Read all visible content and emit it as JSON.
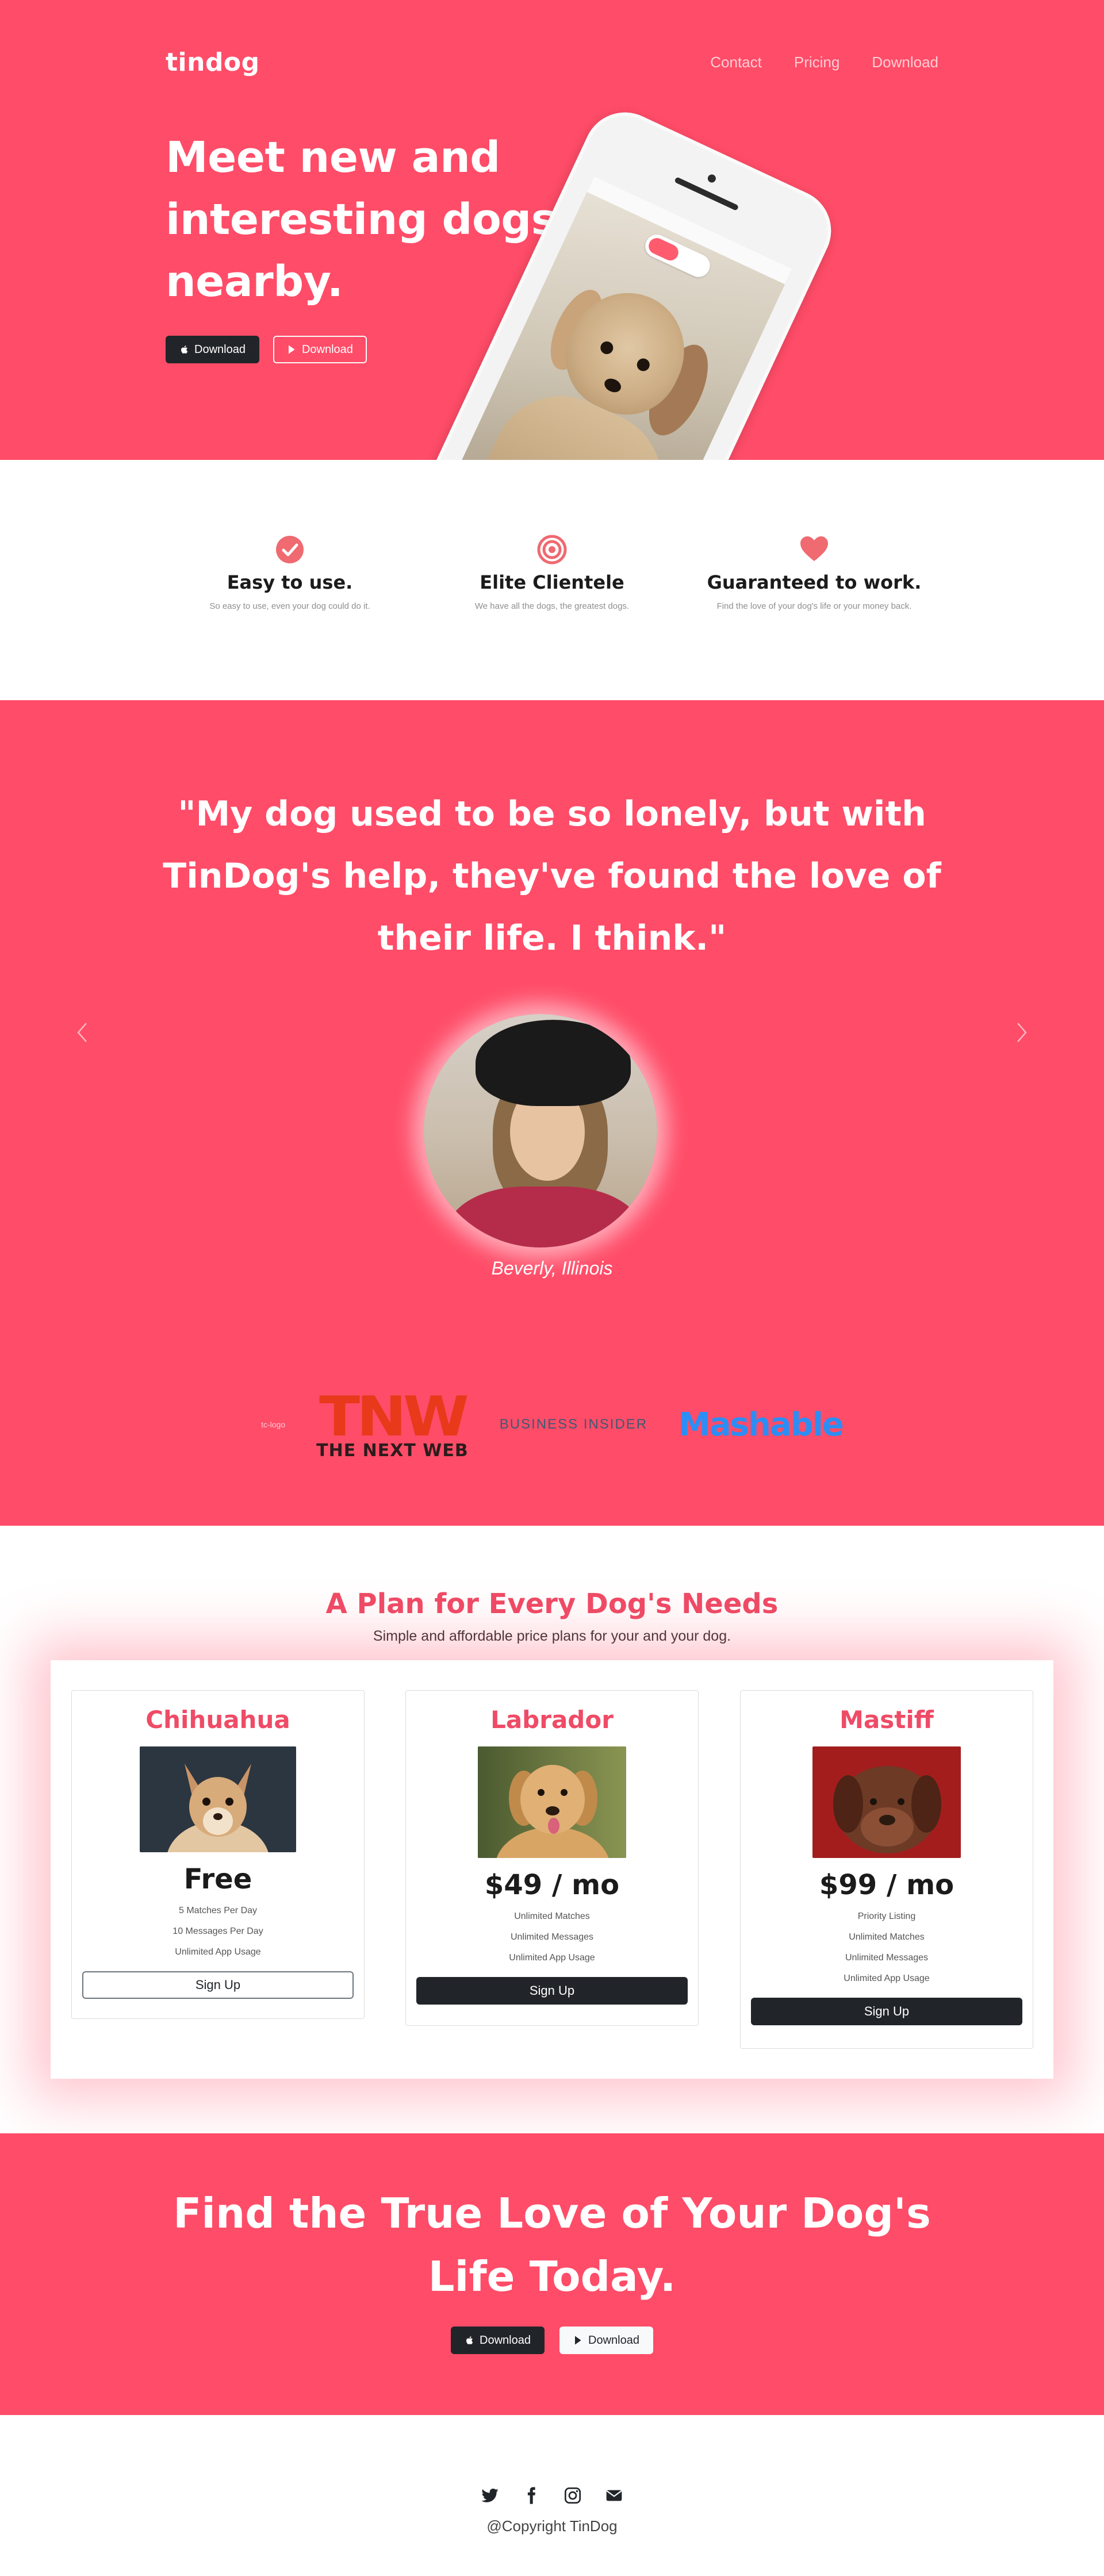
{
  "navbar": {
    "brand": "tindog",
    "links": [
      "Contact",
      "Pricing",
      "Download"
    ]
  },
  "hero": {
    "heading": "Meet new and interesting dogs nearby.",
    "buttons": {
      "apple_label": "Download",
      "google_label": "Download"
    }
  },
  "features": [
    {
      "title": "Easy to use.",
      "text": "So easy to use, even your dog could do it.",
      "icon": "check-circle-icon"
    },
    {
      "title": "Elite Clientele",
      "text": "We have all the dogs, the greatest dogs.",
      "icon": "bullseye-icon"
    },
    {
      "title": "Guaranteed to work.",
      "text": "Find the love of your dog's life or your money back.",
      "icon": "heart-icon"
    }
  ],
  "testimonial": {
    "quote": "\"My dog used to be so lonely, but with TinDog's help, they've found the love of their life. I think.\"",
    "caption": "Beverly, Illinois"
  },
  "press": {
    "broken_image_alt": "tc-logo",
    "tnw_mark": "TNW",
    "tnw_name": "THE NEXT WEB",
    "business_insider": "BUSINESS INSIDER",
    "mashable": "Mashable"
  },
  "pricing": {
    "title": "A Plan for Every Dog's Needs",
    "subtitle": "Simple and affordable price plans for your and your dog.",
    "plans": [
      {
        "name": "Chihuahua",
        "price": "Free",
        "features": [
          "5 Matches Per Day",
          "10 Messages Per Day",
          "Unlimited App Usage"
        ],
        "button": "Sign Up"
      },
      {
        "name": "Labrador",
        "price": "$49 / mo",
        "features": [
          "Unlimited Matches",
          "Unlimited Messages",
          "Unlimited App Usage"
        ],
        "button": "Sign Up"
      },
      {
        "name": "Mastiff",
        "price": "$99 / mo",
        "features": [
          "Priority Listing",
          "Unlimited Matches",
          "Unlimited Messages",
          "Unlimited App Usage"
        ],
        "button": "Sign Up"
      }
    ]
  },
  "cta": {
    "heading": "Find the True Love of Your Dog's Life Today.",
    "buttons": {
      "apple_label": "Download",
      "google_label": "Download"
    }
  },
  "footer": {
    "social_icons": [
      "twitter-icon",
      "facebook-icon",
      "instagram-icon",
      "envelope-icon"
    ],
    "copyright": "@Copyright TinDog"
  },
  "colors": {
    "brand": "#ff4c68",
    "accent_text": "#ef4b66",
    "dark": "#212529"
  }
}
